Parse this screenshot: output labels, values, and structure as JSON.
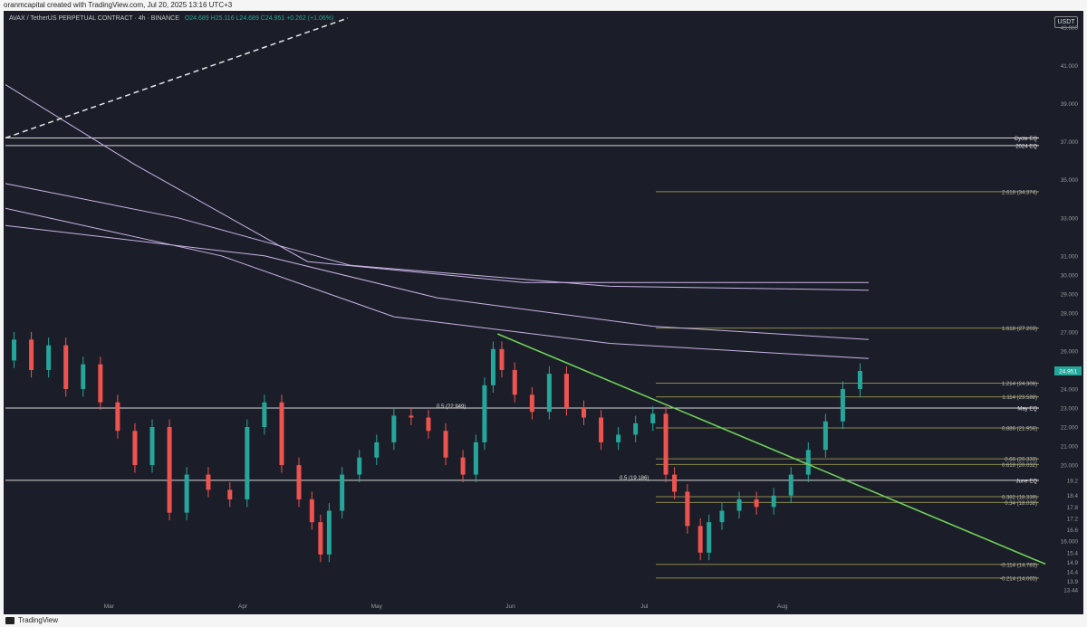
{
  "attribution": "oranmcapital created with TradingView.com, Jul 20, 2025 13:16 UTC+3",
  "header": {
    "symbol": "AVAX / TetherUS PERPETUAL CONTRACT · 4h · BINANCE",
    "ohlc": "O24.689 H25.116 L24.689 C24.951 +0.262 (+1.06%)"
  },
  "currency_button": "USDT",
  "footer_brand": "TradingView",
  "colors": {
    "background": "#1b1e28",
    "up": "#26a69a",
    "down": "#ef5350",
    "trendline": "#6fd15a",
    "fib_level": "#8b8a4a",
    "ma_purple": "#c9b3e6"
  },
  "chart_data": {
    "type": "candlestick",
    "timeframe": "4h",
    "ylim": [
      13.44,
      43.5
    ],
    "price_axis_ticks": [
      43.0,
      41.0,
      39.0,
      37.0,
      35.0,
      33.0,
      31.0,
      30.0,
      29.0,
      28.0,
      27.0,
      26.0,
      25.0,
      24.0,
      23.0,
      22.0,
      21.0,
      20.0,
      19.2,
      18.4,
      17.8,
      17.2,
      16.6,
      16.0,
      15.4,
      14.9,
      14.4,
      13.9,
      13.44
    ],
    "time_axis_ticks": [
      "Mar",
      "Apr",
      "May",
      "Jun",
      "Jul",
      "Aug"
    ],
    "current_price": 24.951,
    "axis_labels": [
      {
        "text": "Cycle EQ",
        "value": 37.2
      },
      {
        "text": "2024 EQ",
        "value": 36.8
      },
      {
        "text": "May EQ",
        "value": 23.0
      },
      {
        "text": "June EQ",
        "value": 19.2
      }
    ],
    "fib_levels": [
      {
        "label": "2.618 (34.374)",
        "value": 34.374
      },
      {
        "label": "1.618 (27.203)",
        "value": 27.203
      },
      {
        "label": "1.214 (24.306)",
        "value": 24.306
      },
      {
        "label": "1.114 (23.588)",
        "value": 23.588
      },
      {
        "label": "0.886 (21.956)",
        "value": 21.956
      },
      {
        "label": "0.66 (20.333)",
        "value": 20.333
      },
      {
        "label": "0.618 (20.032)",
        "value": 20.032
      },
      {
        "label": "0.382 (18.339)",
        "value": 18.339
      },
      {
        "label": "0.34 (18.038)",
        "value": 18.038
      },
      {
        "label": "-0.114 (14.783)",
        "value": 14.783
      },
      {
        "label": "-0.214 (14.065)",
        "value": 14.065
      }
    ],
    "inline_labels": [
      {
        "text": "0.5 (22.949)",
        "value": 22.949
      },
      {
        "text": "0.5 (19.186)",
        "value": 19.186
      }
    ],
    "price_path": [
      [
        0.0,
        25.5
      ],
      [
        0.02,
        26.6
      ],
      [
        0.04,
        25.0
      ],
      [
        0.06,
        26.3
      ],
      [
        0.08,
        24.0
      ],
      [
        0.1,
        25.3
      ],
      [
        0.12,
        23.3
      ],
      [
        0.14,
        21.8
      ],
      [
        0.16,
        20.0
      ],
      [
        0.18,
        22.0
      ],
      [
        0.2,
        17.5
      ],
      [
        0.22,
        19.5
      ],
      [
        0.25,
        18.7
      ],
      [
        0.27,
        18.2
      ],
      [
        0.29,
        22.0
      ],
      [
        0.31,
        23.3
      ],
      [
        0.33,
        20.0
      ],
      [
        0.35,
        18.2
      ],
      [
        0.36,
        17.0
      ],
      [
        0.37,
        15.3
      ],
      [
        0.38,
        17.6
      ],
      [
        0.4,
        19.5
      ],
      [
        0.42,
        20.4
      ],
      [
        0.44,
        21.2
      ],
      [
        0.46,
        22.6
      ],
      [
        0.48,
        22.5
      ],
      [
        0.5,
        21.8
      ],
      [
        0.52,
        20.4
      ],
      [
        0.54,
        19.5
      ],
      [
        0.55,
        21.2
      ],
      [
        0.56,
        24.2
      ],
      [
        0.57,
        26.1
      ],
      [
        0.58,
        25.0
      ],
      [
        0.6,
        23.7
      ],
      [
        0.62,
        22.8
      ],
      [
        0.64,
        24.8
      ],
      [
        0.66,
        23.0
      ],
      [
        0.68,
        22.5
      ],
      [
        0.7,
        21.2
      ],
      [
        0.72,
        21.6
      ],
      [
        0.74,
        22.2
      ],
      [
        0.76,
        22.7
      ],
      [
        0.77,
        19.5
      ],
      [
        0.78,
        18.6
      ],
      [
        0.8,
        16.8
      ],
      [
        0.81,
        15.4
      ],
      [
        0.82,
        17.0
      ],
      [
        0.84,
        17.6
      ],
      [
        0.86,
        18.2
      ],
      [
        0.88,
        17.8
      ],
      [
        0.9,
        18.4
      ],
      [
        0.92,
        19.5
      ],
      [
        0.94,
        20.8
      ],
      [
        0.96,
        22.3
      ],
      [
        0.98,
        24.0
      ],
      [
        1.0,
        24.95
      ]
    ],
    "moving_averages": [
      {
        "color": "#c9b3e6",
        "points": [
          [
            0.0,
            40.0
          ],
          [
            0.15,
            35.8
          ],
          [
            0.35,
            30.7
          ],
          [
            0.6,
            29.6
          ],
          [
            1.0,
            29.6
          ]
        ]
      },
      {
        "color": "#c9b3e6",
        "points": [
          [
            0.0,
            34.8
          ],
          [
            0.2,
            33.0
          ],
          [
            0.4,
            30.5
          ],
          [
            0.7,
            29.4
          ],
          [
            1.0,
            29.2
          ]
        ]
      },
      {
        "color": "#c9b3e6",
        "points": [
          [
            0.0,
            32.6
          ],
          [
            0.3,
            31.0
          ],
          [
            0.5,
            28.8
          ],
          [
            0.75,
            27.3
          ],
          [
            1.0,
            26.6
          ]
        ]
      },
      {
        "color": "#c9b3e6",
        "points": [
          [
            0.0,
            33.5
          ],
          [
            0.25,
            31.0
          ],
          [
            0.45,
            27.8
          ],
          [
            0.7,
            26.4
          ],
          [
            1.0,
            25.6
          ]
        ]
      }
    ]
  }
}
